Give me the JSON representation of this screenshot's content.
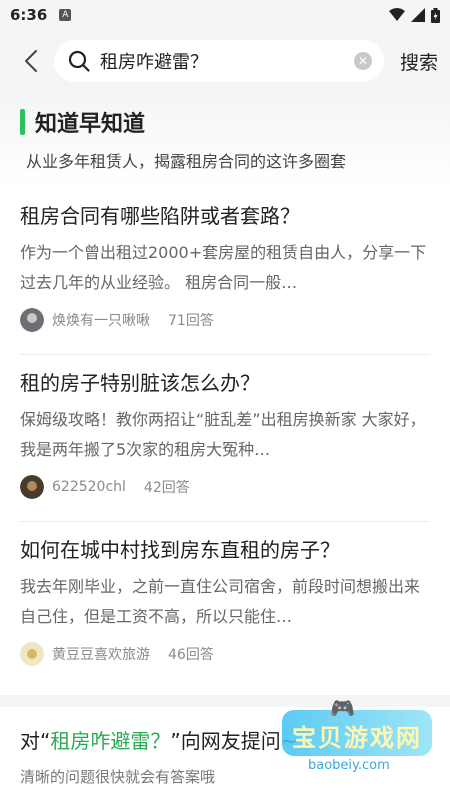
{
  "status": {
    "time": "6:36",
    "badge": "A"
  },
  "topbar": {
    "query": "租房咋避雷？",
    "search_label": "搜索"
  },
  "banner": {
    "title": "知道早知道",
    "subtitle": "从业多年租赁人，揭露租房合同的这许多圈套"
  },
  "questions": [
    {
      "title": "租房合同有哪些陷阱或者套路？",
      "desc": "作为一个曾出租过2000+套房屋的租赁自由人，分享一下过去几年的从业经验。 租房合同一般…",
      "author": "焕焕有一只啾啾",
      "answers": "71回答"
    },
    {
      "title": "租的房子特别脏该怎么办？",
      "desc": "保姆级攻略！教你两招让“脏乱差”出租房换新家 大家好，我是两年搬了5次家的租房大冤种…",
      "author": "622520chl",
      "answers": "42回答"
    },
    {
      "title": "如何在城中村找到房东直租的房子？",
      "desc": "我去年刚毕业，之前一直住公司宿舍，前段时间想搬出来自己住，但是工资不高，所以只能住…",
      "author": "黄豆豆喜欢旅游",
      "answers": "46回答"
    }
  ],
  "ask": {
    "prefix": "对“",
    "highlight": "租房咋避雷？",
    "suffix": "”向网友提问~",
    "hint": "清晰的问题很快就会有答案哦"
  },
  "watermark": {
    "brand": "宝贝游戏网",
    "url": "baobeiy.com"
  },
  "colors": {
    "accent": "#2fbf5f",
    "background": "#f4f5f6"
  }
}
